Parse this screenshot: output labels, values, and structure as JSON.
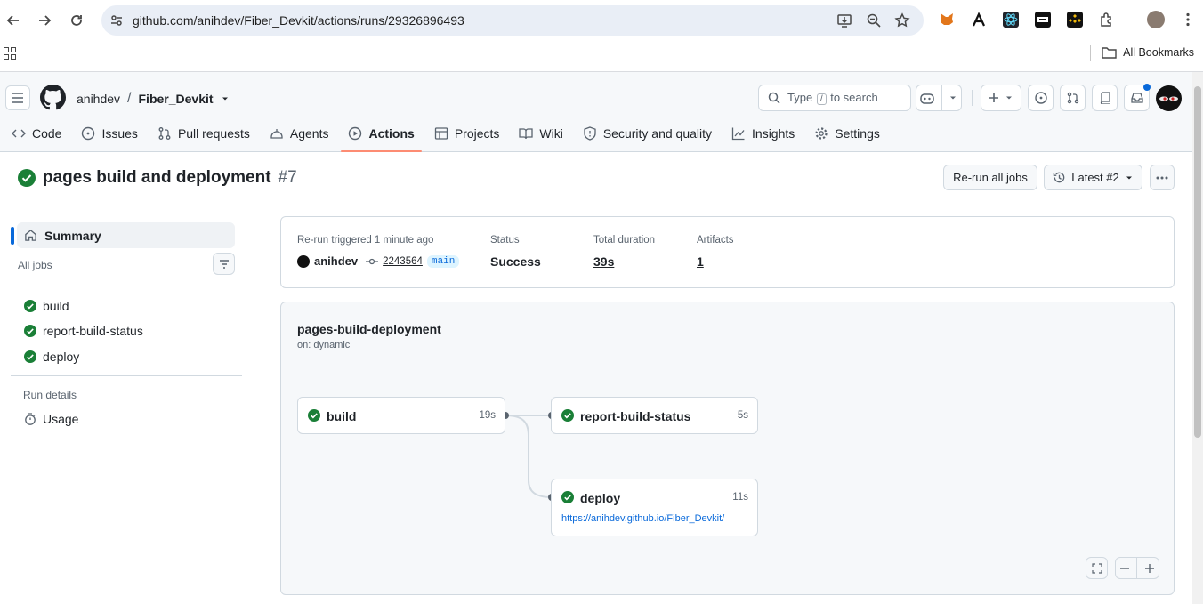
{
  "browser": {
    "url": "github.com/anihdev/Fiber_Devkit/actions/runs/29326896493",
    "all_bookmarks": "All Bookmarks"
  },
  "header": {
    "owner": "anihdev",
    "separator": "/",
    "repo": "Fiber_Devkit",
    "search_prefix": "Type",
    "search_key": "/",
    "search_suffix": "to search"
  },
  "tabs": [
    {
      "label": "Code"
    },
    {
      "label": "Issues"
    },
    {
      "label": "Pull requests"
    },
    {
      "label": "Agents"
    },
    {
      "label": "Actions"
    },
    {
      "label": "Projects"
    },
    {
      "label": "Wiki"
    },
    {
      "label": "Security and quality"
    },
    {
      "label": "Insights"
    },
    {
      "label": "Settings"
    }
  ],
  "run": {
    "title": "pages build and deployment",
    "number": "#7",
    "rerun_label": "Re-run all jobs",
    "attempt_label": "Latest #2"
  },
  "sidebar": {
    "summary": "Summary",
    "all_jobs": "All jobs",
    "jobs": [
      {
        "label": "build"
      },
      {
        "label": "report-build-status"
      },
      {
        "label": "deploy"
      }
    ],
    "run_details": "Run details",
    "usage": "Usage"
  },
  "summary": {
    "trigger_label": "Re-run triggered 1 minute ago",
    "actor": "anihdev",
    "commit": "2243564",
    "branch": "main",
    "status_label": "Status",
    "status_value": "Success",
    "duration_label": "Total duration",
    "duration_value": "39s",
    "artifacts_label": "Artifacts",
    "artifacts_value": "1"
  },
  "graph": {
    "workflow_name": "pages-build-deployment",
    "trigger": "on: dynamic",
    "jobs": {
      "build": {
        "name": "build",
        "duration": "19s"
      },
      "report": {
        "name": "report-build-status",
        "duration": "5s"
      },
      "deploy": {
        "name": "deploy",
        "duration": "11s",
        "url": "https://anihdev.github.io/Fiber_Devkit/"
      }
    }
  },
  "colors": {
    "success": "#1a7f37",
    "accent_link": "#0969da",
    "active_tab_underline": "#fd8c73"
  }
}
